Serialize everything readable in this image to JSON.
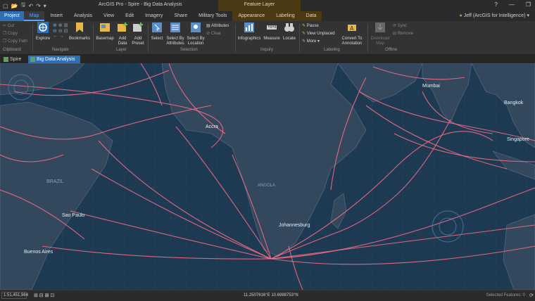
{
  "titlebar": {
    "title": "ArcGIS Pro - Spire - Big Data Analysis",
    "context_header": "Feature Layer",
    "help": "?",
    "minimize": "—",
    "restore": "❐"
  },
  "tabs": [
    "Project",
    "Map",
    "Insert",
    "Analysis",
    "View",
    "Edit",
    "Imagery",
    "Share",
    "Military Tools"
  ],
  "context_tabs": [
    "Appearance",
    "Labeling",
    "Data"
  ],
  "user": "Jeff (ArcGIS for Intelligence)",
  "ribbon": {
    "clipboard": {
      "cut": "Cut",
      "copy": "Copy",
      "copy_path": "Copy Path",
      "label": "Clipboard"
    },
    "navigate": {
      "explore": "Explore",
      "bookmarks": "Bookmarks",
      "label": "Navigate"
    },
    "layer": {
      "basemap": "Basemap",
      "add_data": "Add Data",
      "add_preset": "Add Preset",
      "label": "Layer"
    },
    "selection": {
      "select": "Select",
      "by_attributes": "Select By Attributes",
      "by_location": "Select By Location",
      "attributes": "Attributes",
      "clear": "Clear",
      "label": "Selection"
    },
    "inquiry": {
      "infographics": "Infographics",
      "measure": "Measure",
      "locate": "Locate",
      "label": "Inquiry"
    },
    "labeling": {
      "pause": "Pause",
      "view_unplaced": "View Unplaced",
      "more": "More",
      "convert": "Convert To Annotation",
      "label": "Labeling"
    },
    "offline": {
      "download": "Download Map",
      "sync": "Sync",
      "remove": "Remove",
      "label": "Offline"
    }
  },
  "view_tabs": [
    {
      "label": "Spire",
      "active": false
    },
    {
      "label": "Big Data Analysis",
      "active": true,
      "close": "✕"
    }
  ],
  "map": {
    "labels": [
      "BRAZIL",
      "Sao Paulo",
      "Buenos Aires",
      "Accra",
      "Johannesburg",
      "Mumbai",
      "Bangkok",
      "Singapore",
      "ANGOLA"
    ]
  },
  "status": {
    "scale": "1:51,451,964",
    "coordinates": "11.2507616°E 10.6988753°N",
    "selected": "Selected Features: 0"
  },
  "colors": {
    "accent": "#2f6fb5",
    "track": "#ff6f8a",
    "ocean": "#1e3a52",
    "land": "#33485c",
    "context": "#4a3a14"
  }
}
